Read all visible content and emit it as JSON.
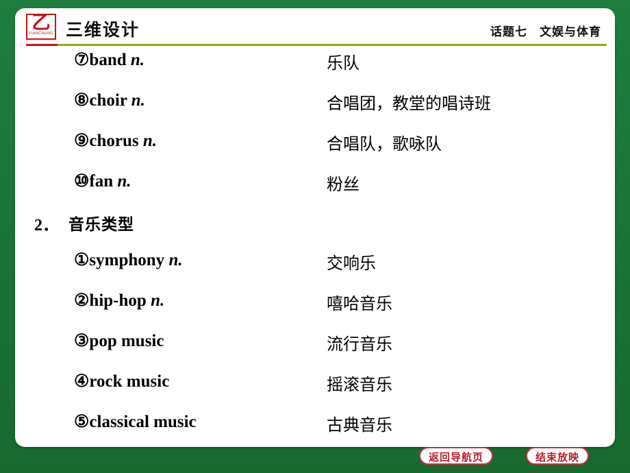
{
  "header": {
    "logo_glyph": "乙",
    "logo_sub": "TIANCHENG",
    "brand": "三维设计",
    "topic": "话题七　文娱与体育"
  },
  "vocab_list_1": [
    {
      "term": "⑦band ",
      "pos": "n.",
      "cn": "乐队"
    },
    {
      "term": "⑧choir ",
      "pos": "n.",
      "cn": "合唱团，教堂的唱诗班"
    },
    {
      "term": "⑨chorus ",
      "pos": "n.",
      "cn": "合唱队，歌咏队"
    },
    {
      "term": "⑩fan ",
      "pos": "n.",
      "cn": "粉丝"
    }
  ],
  "section": {
    "number": "2．",
    "title": "音乐类型"
  },
  "vocab_list_2": [
    {
      "term": "①symphony ",
      "pos": "n.",
      "cn": "交响乐"
    },
    {
      "term": "②hip-hop ",
      "pos": "n.",
      "cn": "嘻哈音乐"
    },
    {
      "term": "③pop music",
      "pos": "",
      "cn": "流行音乐"
    },
    {
      "term": "④rock music",
      "pos": "",
      "cn": "摇滚音乐"
    },
    {
      "term": "⑤classical music",
      "pos": "",
      "cn": "古典音乐"
    }
  ],
  "footer": {
    "nav_label": "返回导航页",
    "end_label": "结束放映"
  },
  "colors": {
    "background": "#1d7b3e",
    "page": "#ffffff",
    "logo_red": "#c0141b",
    "rule_olive": "#9aa515",
    "button_border": "#c9303a",
    "button_text": "#b51f26"
  }
}
